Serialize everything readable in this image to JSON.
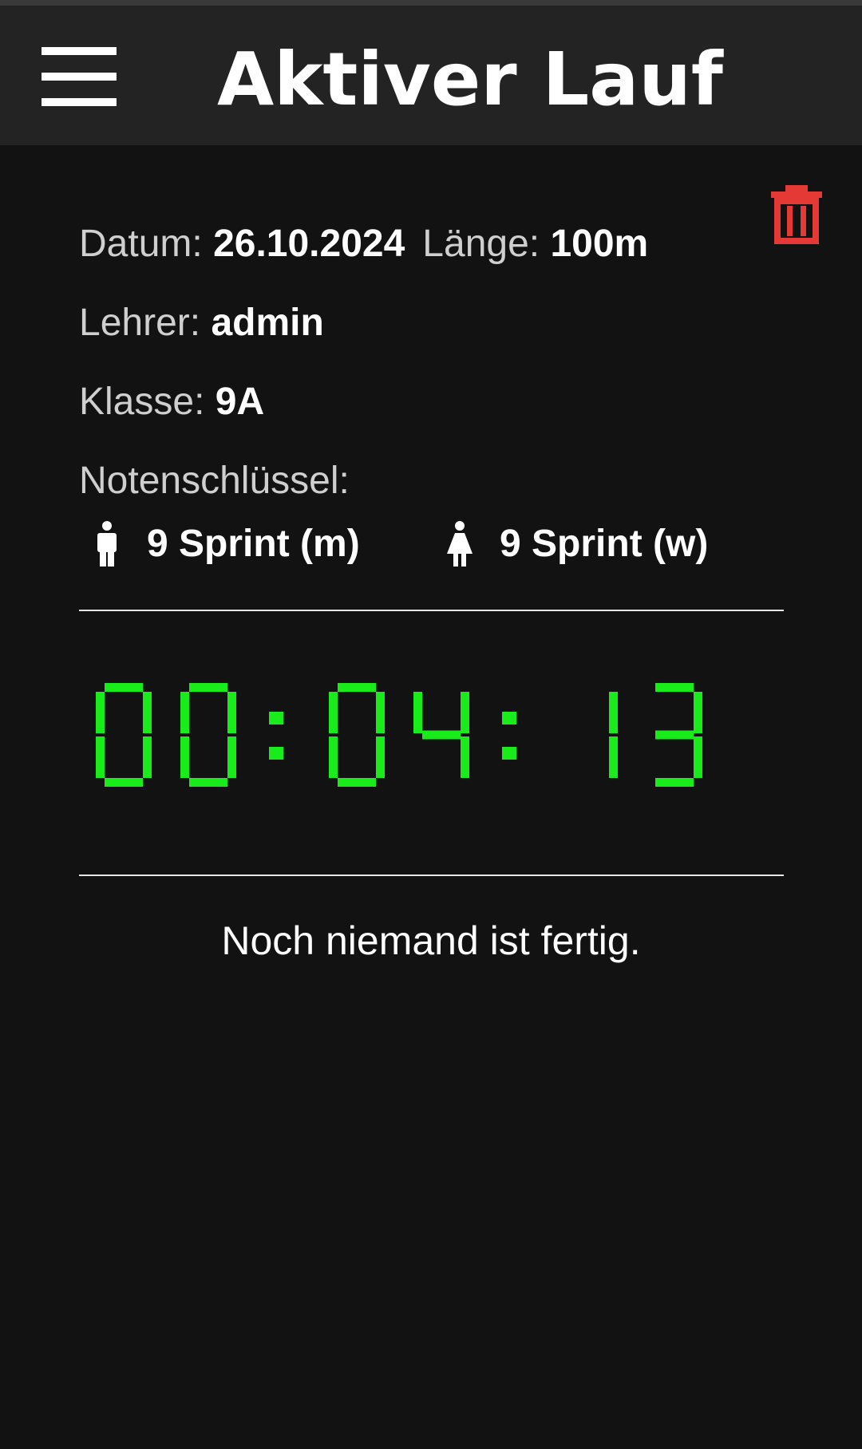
{
  "app_bar": {
    "title": "Aktiver Lauf",
    "menu_icon": "hamburger-menu-icon"
  },
  "actions": {
    "delete_icon": "trash-icon",
    "delete_color": "#e53935"
  },
  "run_info": {
    "date_label": "Datum:",
    "date_value": "26.10.2024",
    "length_label": "Länge:",
    "length_value": "100m",
    "teacher_label": "Lehrer:",
    "teacher_value": "admin",
    "class_label": "Klasse:",
    "class_value": "9A",
    "grade_key_label": "Notenschlüssel:",
    "grade_keys": [
      {
        "icon": "male-person-icon",
        "label": "9 Sprint (m)"
      },
      {
        "icon": "female-person-icon",
        "label": "9 Sprint (w)"
      }
    ]
  },
  "timer": {
    "value": "00:04:13",
    "color": "#1aeb1a"
  },
  "results": {
    "empty_message": "Noch niemand ist fertig."
  }
}
